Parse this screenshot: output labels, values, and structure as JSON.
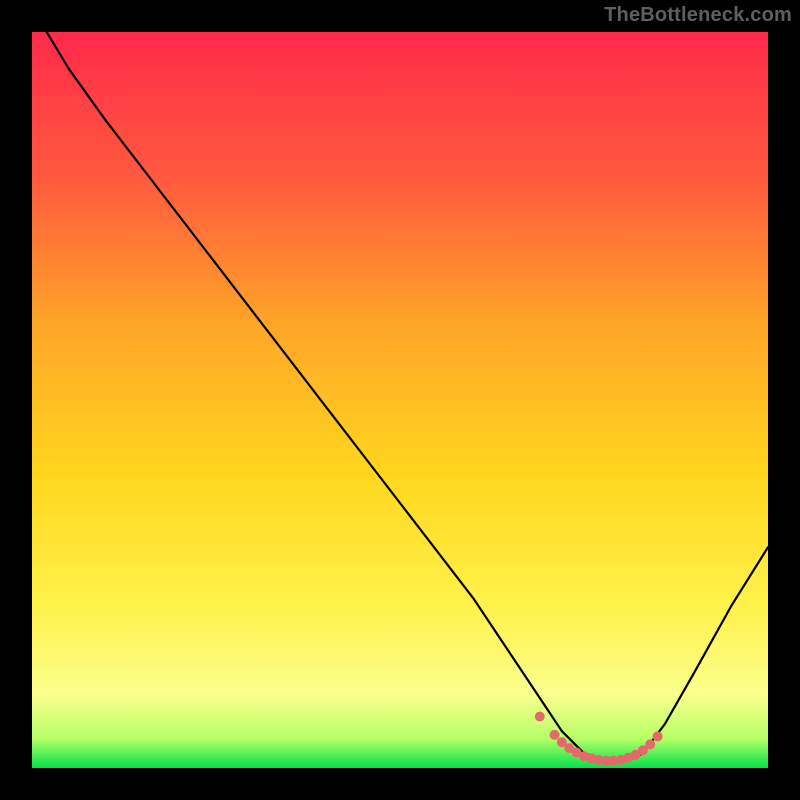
{
  "watermark": "TheBottleneck.com",
  "chart_data": {
    "type": "line",
    "title": "",
    "xlabel": "",
    "ylabel": "",
    "xlim": [
      0,
      100
    ],
    "ylim": [
      0,
      100
    ],
    "background_gradient_stops": [
      {
        "offset": 0,
        "color": "#ff2a49"
      },
      {
        "offset": 20,
        "color": "#ff5a3e"
      },
      {
        "offset": 40,
        "color": "#ffa628"
      },
      {
        "offset": 60,
        "color": "#ffd61e"
      },
      {
        "offset": 78,
        "color": "#fff24a"
      },
      {
        "offset": 90,
        "color": "#fbff8e"
      },
      {
        "offset": 96,
        "color": "#b7ff66"
      },
      {
        "offset": 100,
        "color": "#04e24a"
      }
    ],
    "series": [
      {
        "name": "bottleneck-curve",
        "color": "#000000",
        "x": [
          2,
          5,
          10,
          20,
          30,
          40,
          50,
          60,
          66,
          70,
          72,
          75,
          78,
          81,
          83,
          86,
          90,
          95,
          100
        ],
        "y": [
          100,
          95,
          88,
          75,
          62,
          49,
          36,
          23,
          14,
          8,
          5,
          2,
          1,
          1,
          2,
          6,
          13,
          22,
          30
        ]
      }
    ],
    "markers": {
      "name": "highlight-region",
      "color": "#e46a6a",
      "x": [
        69,
        71,
        72,
        73,
        74,
        75,
        76,
        77,
        78,
        79,
        80,
        81,
        82,
        83,
        84,
        85
      ],
      "y": [
        7,
        4.5,
        3.5,
        2.7,
        2.1,
        1.6,
        1.3,
        1.1,
        1.0,
        1.0,
        1.1,
        1.4,
        1.8,
        2.4,
        3.2,
        4.3
      ]
    }
  }
}
